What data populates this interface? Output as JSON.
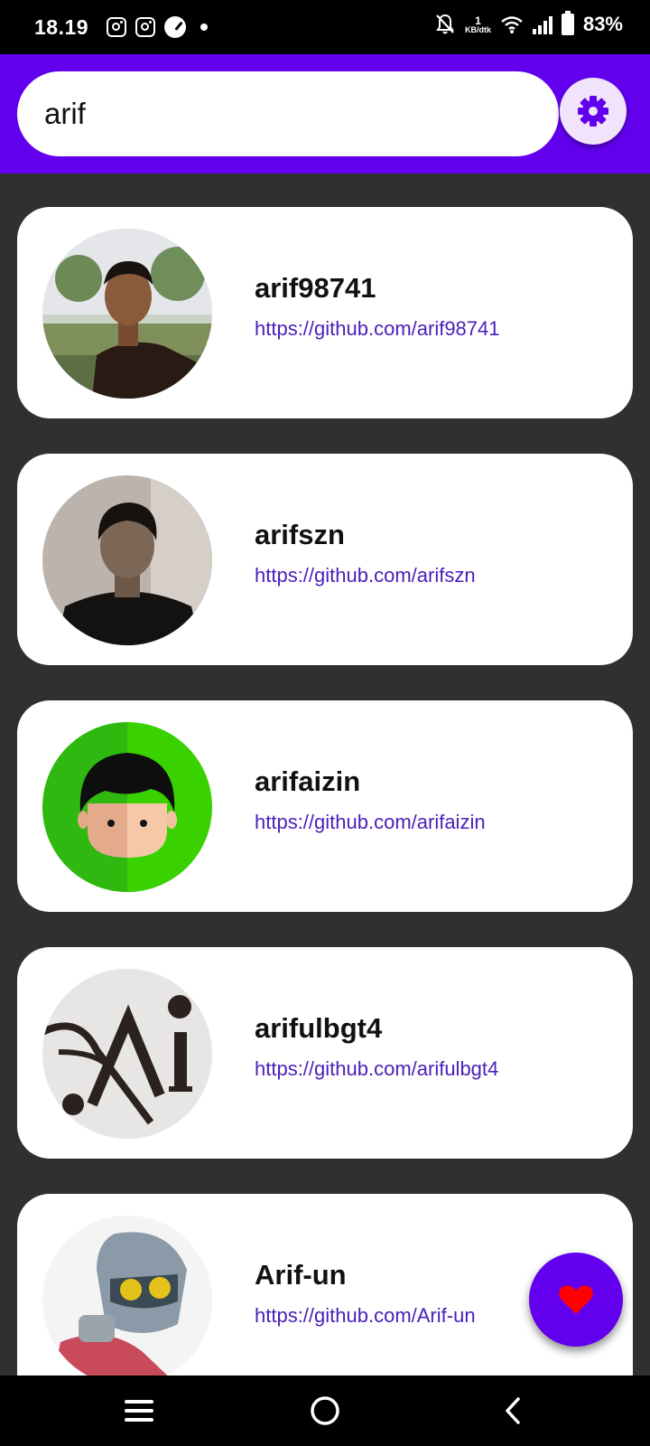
{
  "status_bar": {
    "time": "18.19",
    "net_speed_value": "1",
    "net_speed_unit": "KB/dtk",
    "battery": "83%"
  },
  "search": {
    "value": "arif"
  },
  "icons": {
    "settings": "gear-icon",
    "favorite": "heart-icon",
    "nav_recents": "menu-icon",
    "nav_home": "home-circle-icon",
    "nav_back": "chevron-left-icon"
  },
  "colors": {
    "primary": "#6200ee",
    "background": "#303030",
    "link": "#4a1fb8",
    "heart": "#ff0000"
  },
  "users": [
    {
      "username": "arif98741",
      "url": "https://github.com/arif98741"
    },
    {
      "username": "arifszn",
      "url": "https://github.com/arifszn"
    },
    {
      "username": "arifaizin",
      "url": "https://github.com/arifaizin"
    },
    {
      "username": "arifulbgt4",
      "url": "https://github.com/arifulbgt4"
    },
    {
      "username": "Arif-un",
      "url": "https://github.com/Arif-un"
    }
  ]
}
